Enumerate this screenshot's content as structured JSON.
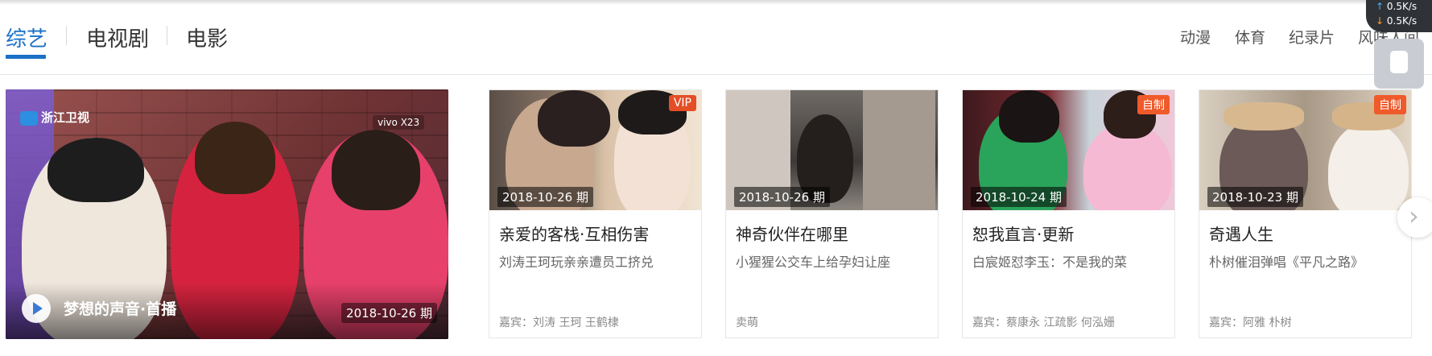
{
  "tabs": {
    "main": [
      {
        "label": "综艺",
        "active": true
      },
      {
        "label": "电视剧",
        "active": false
      },
      {
        "label": "电影",
        "active": false
      }
    ],
    "right": [
      {
        "label": "动漫"
      },
      {
        "label": "体育"
      },
      {
        "label": "纪录片"
      },
      {
        "label": "风味人间"
      }
    ]
  },
  "featured": {
    "channel_logo": "浙江卫视",
    "sponsor": "vivo X23",
    "title": "梦想的声音·首播",
    "date": "2018-10-26 期"
  },
  "cards": [
    {
      "badge": "VIP",
      "date": "2018-10-26 期",
      "title": "亲爱的客栈·互相伤害",
      "desc": "刘涛王珂玩亲亲遭员工挤兑",
      "guests": "嘉宾：刘涛 王珂 王鹤棣"
    },
    {
      "badge": "",
      "date": "2018-10-26 期",
      "title": "神奇伙伴在哪里",
      "desc": "小猩猩公交车上给孕妇让座",
      "guests": "卖萌"
    },
    {
      "badge": "自制",
      "date": "2018-10-24 期",
      "title": "恕我直言·更新",
      "desc": "白宸姬怼李玉：不是我的菜",
      "guests": "嘉宾：蔡康永 江疏影 何泓姗"
    },
    {
      "badge": "自制",
      "date": "2018-10-23 期",
      "title": "奇遇人生",
      "desc": "朴树催泪弹唱《平凡之路》",
      "guests": "嘉宾：阿雅 朴树"
    }
  ],
  "netspeed": {
    "up": "0.5K/s",
    "down": "0.5K/s"
  },
  "colors": {
    "accent": "#1a71c6",
    "badge": "#f05a2a"
  },
  "icons": {
    "play": "play-icon",
    "next": "chevron-right-icon",
    "side": "usb-icon"
  }
}
